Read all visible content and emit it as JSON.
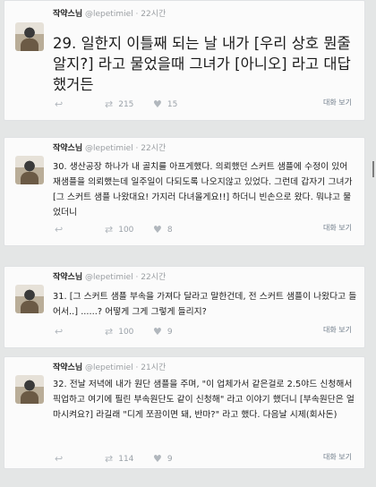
{
  "tweets": [
    {
      "name": "작약스님",
      "handle": "@lepetimiel",
      "sep": "·",
      "time": "22시간",
      "text": "29. 일한지 이틀째 되는 날 내가 [우리 상호 뭔줄 알지?] 라고 물었을때 그녀가 [아니오] 라고 대답 했거든",
      "retweets": "215",
      "likes": "15",
      "conversation": "대화 보기"
    },
    {
      "name": "작약스님",
      "handle": "@lepetimiel",
      "sep": "·",
      "time": "22시간",
      "text": "30. 생산공장 하나가 내 골치를 아프게했다. 의뢰했던 스커트 샘플에 수정이 있어 재샘플을 의뢰했는데 일주일이 다되도록 나오지않고 있었다. 그런데 갑자기 그녀가 [그 스커트 샘플 나왔대요! 가지러 다녀올게요!!] 하더니 빈손으로 왔다. 뭐냐고 물었더니",
      "retweets": "100",
      "likes": "8",
      "conversation": "대화 보기"
    },
    {
      "name": "작약스님",
      "handle": "@lepetimiel",
      "sep": "·",
      "time": "22시간",
      "text": "31. [그 스커트 샘플 부속을 가져다 달라고 말한건데, 전 스커트 샘플이 나왔다고 들어서..] ......? 어떻게 그게 그렇게 들리지?",
      "retweets": "100",
      "likes": "9",
      "conversation": "대화 보기"
    },
    {
      "name": "작약스님",
      "handle": "@lepetimiel",
      "sep": "·",
      "time": "21시간",
      "text": "32. 전날 저녁에 내가 원단 샘플을 주며, \"이 업체가서 같은걸로 2.5야드 신청해서 픽업하고 여기에 필린 부속원단도 같이 신청해\" 라고 이야기 했더니 [부속원단은 얼마시켜요?] 라길래 \"디게 쪼끔이면 돼, 반마?\" 라고 했다. 다음날 시제(회사돈)",
      "retweets": "114",
      "likes": "9",
      "conversation": "대화 보기"
    }
  ]
}
